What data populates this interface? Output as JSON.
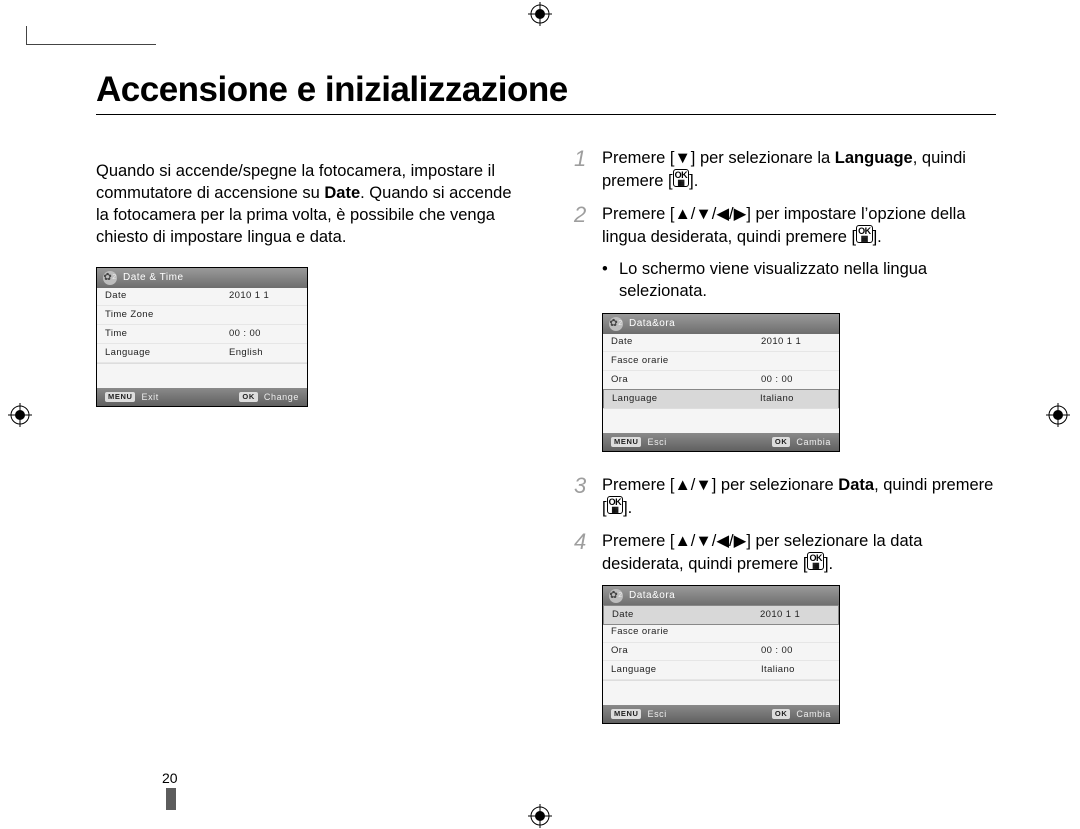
{
  "page_number": "20",
  "heading": "Accensione e inizializzazione",
  "intro_plain": "Quando si accende/spegne la fotocamera, impostare il commutatore di accensione su Date. Quando si accende la fotocamera per la prima volta, è possibile che venga chiesto di impostare lingua e data.",
  "intro_bold": "Date",
  "glyphs": {
    "down": "▼",
    "up": "▲",
    "left": "◀",
    "right": "▶",
    "ok_top": "OK",
    "ok_bot": "⌸"
  },
  "steps": {
    "s1": {
      "num": "1",
      "pre": "Premere [",
      "mid": "] per selezionare la ",
      "bold": "Language",
      "post": ", quindi premere ["
    },
    "s2": {
      "num": "2",
      "pre": "Premere [",
      "mid": "] per impostare l’opzione della lingua desiderata, quindi premere ["
    },
    "s2_sub_bullet": "•",
    "s2_sub": "Lo schermo viene visualizzato nella lingua selezionata.",
    "s3": {
      "num": "3",
      "pre": "Premere [",
      "mid": "] per selezionare ",
      "bold": "Data",
      "post": ", quindi premere ["
    },
    "s4": {
      "num": "4",
      "pre": "Premere [",
      "mid": "] per selezionare la data desiderata, quindi premere ["
    }
  },
  "menu_en": {
    "title": "Date & Time",
    "gear_badge": "2",
    "rows": [
      {
        "label": "Date",
        "value": "2010   1   1"
      },
      {
        "label": "Time Zone",
        "value": ""
      },
      {
        "label": "Time",
        "value": "00 : 00"
      },
      {
        "label": "Language",
        "value": "English"
      }
    ],
    "footer": {
      "menu_pill": "MENU",
      "exit": "Exit",
      "ok_pill": "OK",
      "change": "Change"
    }
  },
  "menu_it1": {
    "title": "Data&ora",
    "gear_badge": "2",
    "rows": [
      {
        "label": "Date",
        "value": "2010   1   1"
      },
      {
        "label": "Fasce orarie",
        "value": ""
      },
      {
        "label": "Ora",
        "value": "00 : 00"
      },
      {
        "label": "Language",
        "value": "Italiano"
      }
    ],
    "highlight": 3,
    "footer": {
      "menu_pill": "MENU",
      "exit": "Esci",
      "ok_pill": "OK",
      "change": "Cambia"
    }
  },
  "menu_it2": {
    "title": "Data&ora",
    "gear_badge": "2",
    "rows": [
      {
        "label": "Date",
        "value": "2010   1   1"
      },
      {
        "label": "Fasce orarie",
        "value": ""
      },
      {
        "label": "Ora",
        "value": "00 : 00"
      },
      {
        "label": "Language",
        "value": "Italiano"
      }
    ],
    "highlight": 0,
    "footer": {
      "menu_pill": "MENU",
      "exit": "Esci",
      "ok_pill": "OK",
      "change": "Cambia"
    }
  }
}
